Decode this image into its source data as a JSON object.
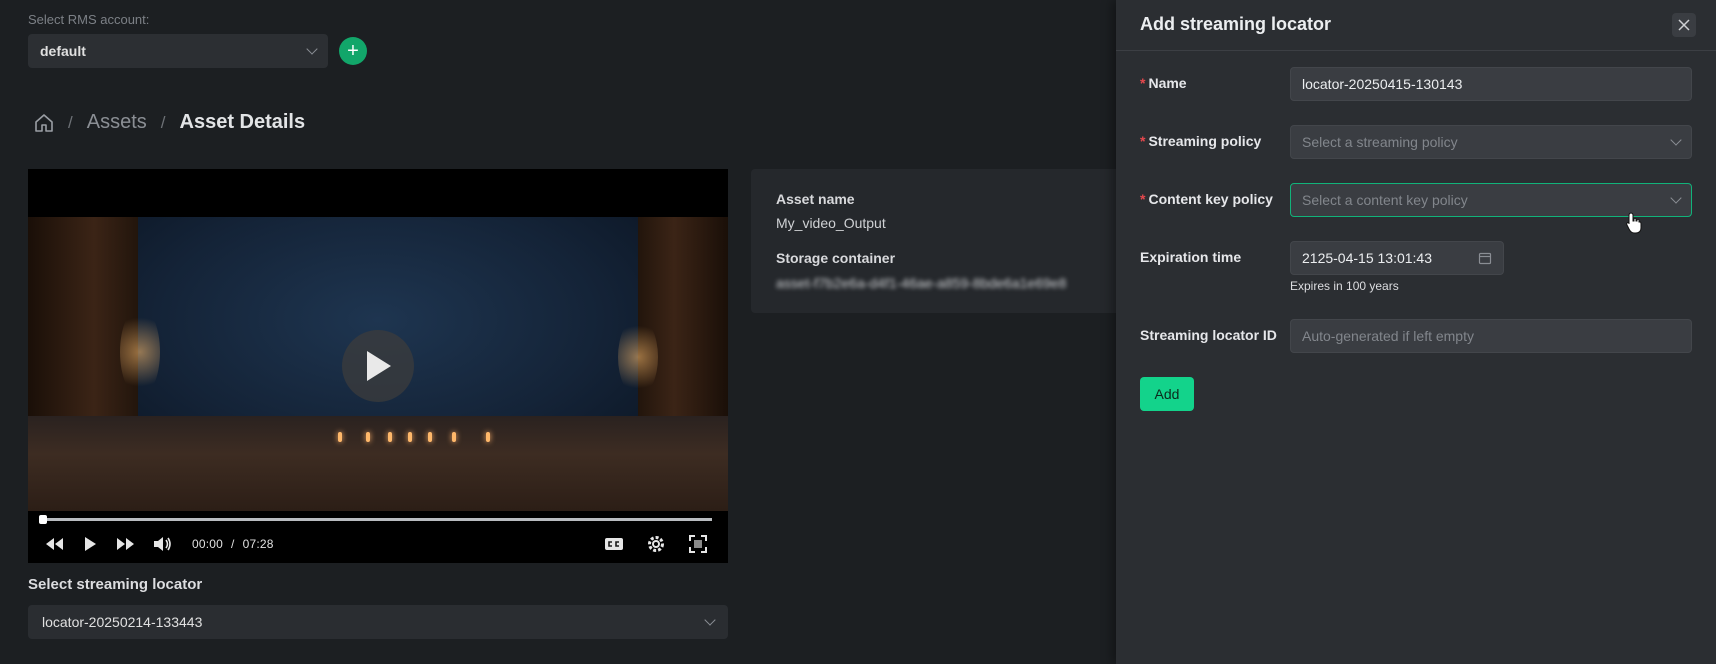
{
  "rms": {
    "label": "Select RMS account:",
    "value": "default",
    "add_icon": "plus-icon"
  },
  "breadcrumb": {
    "home_icon": "home-icon",
    "items": [
      "Assets",
      "Asset Details"
    ]
  },
  "player": {
    "current_time": "00:00",
    "separator": "/",
    "duration": "07:28",
    "progress": 0,
    "icons": [
      "rewind-icon",
      "play-icon",
      "fast-forward-icon",
      "volume-icon",
      "captions-icon",
      "settings-icon",
      "fullscreen-icon"
    ]
  },
  "streaming_locator": {
    "label": "Select streaming locator",
    "value": "locator-20250214-133443"
  },
  "asset": {
    "name_label": "Asset name",
    "name_value": "My_video_Output",
    "container_label": "Storage container",
    "container_value": "asset-f7b2e6a-d4f1-46ae-a859-8bde6a1e69e8"
  },
  "drawer": {
    "title": "Add streaming locator",
    "fields": {
      "name": {
        "label": "Name",
        "value": "locator-20250415-130143",
        "required": true
      },
      "streaming_policy": {
        "label": "Streaming policy",
        "placeholder": "Select a streaming policy",
        "required": true
      },
      "content_key_policy": {
        "label": "Content key policy",
        "placeholder": "Select a content key policy",
        "required": true
      },
      "expiration": {
        "label": "Expiration time",
        "value": "2125-04-15 13:01:43",
        "hint": "Expires in 100 years"
      },
      "locator_id": {
        "label": "Streaming locator ID",
        "placeholder": "Auto-generated if left empty"
      }
    },
    "add_button": "Add"
  },
  "colors": {
    "accent": "#13d38b",
    "required": "#e5484d",
    "background": "#1c1f22",
    "panel": "#2b2e32"
  }
}
